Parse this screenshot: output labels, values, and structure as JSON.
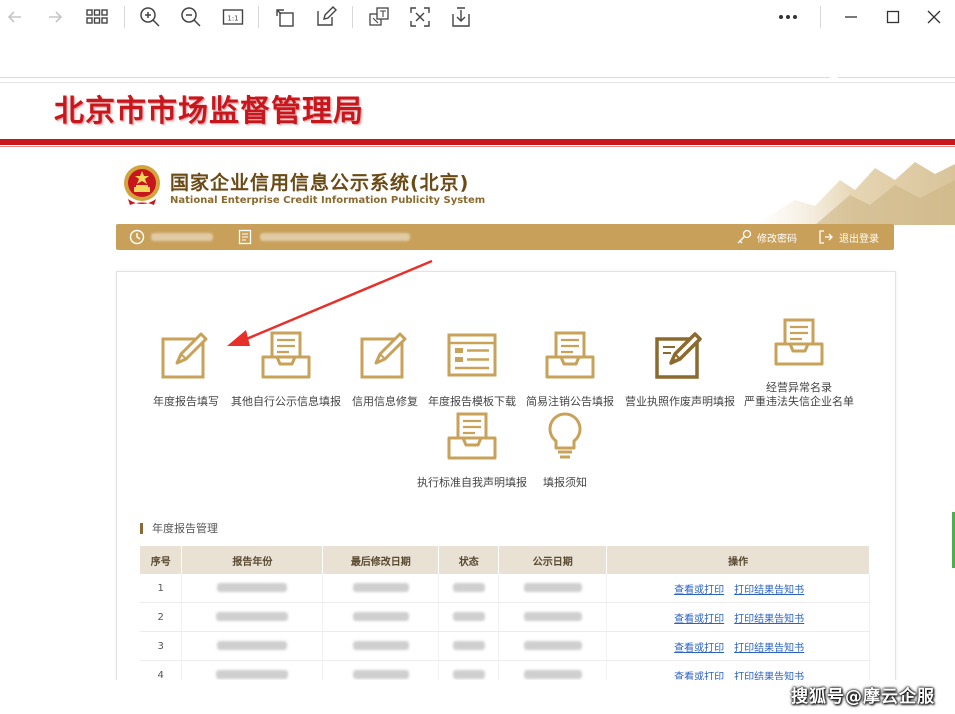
{
  "browser_toolbar": {
    "buttons": [
      {
        "name": "back-arrow-icon"
      },
      {
        "name": "forward-arrow-icon"
      },
      {
        "name": "grid-icon"
      },
      {
        "name": "zoom-in-icon"
      },
      {
        "name": "zoom-out-icon"
      },
      {
        "name": "actual-size-icon",
        "text": "1:1"
      },
      {
        "name": "rotate-icon"
      },
      {
        "name": "edit-icon"
      },
      {
        "name": "translate-icon"
      },
      {
        "name": "screenshot-icon"
      },
      {
        "name": "download-icon"
      }
    ],
    "window_controls": [
      "more-icon",
      "minimize-icon",
      "maximize-icon",
      "close-icon"
    ]
  },
  "header": {
    "bureau_title": "北京市市场监督管理局"
  },
  "system": {
    "title": "国家企业信用信息公示系统(北京)",
    "subtitle": "National Enterprise Credit Information Publicity System"
  },
  "userbar": {
    "change_password": "修改密码",
    "logout": "退出登录"
  },
  "tiles": [
    {
      "label": "年度报告填写",
      "icon": "pencil-board-icon"
    },
    {
      "label": "其他自行公示信息填报",
      "icon": "inbox-tray-icon"
    },
    {
      "label": "信用信息修复",
      "icon": "pencil-board-icon"
    },
    {
      "label": "年度报告模板下载",
      "icon": "template-form-icon"
    },
    {
      "label": "简易注销公告填报",
      "icon": "inbox-tray-icon"
    },
    {
      "label": "营业执照作废声明填报",
      "icon": "pencil-board-icon"
    },
    {
      "label": "经营异常名录",
      "label2": "严重违法失信企业名单",
      "icon": "inbox-tray-icon"
    },
    {
      "label": "执行标准自我声明填报",
      "icon": "inbox-tray-icon"
    },
    {
      "label": "填报须知",
      "icon": "lightbulb-icon"
    }
  ],
  "section": {
    "title": "年度报告管理"
  },
  "table": {
    "headers": [
      "序号",
      "报告年份",
      "最后修改日期",
      "状态",
      "公示日期",
      "操作"
    ],
    "rows": [
      {
        "no": "1",
        "view": "查看或打印",
        "print": "打印结果告知书"
      },
      {
        "no": "2",
        "view": "查看或打印",
        "print": "打印结果告知书"
      },
      {
        "no": "3",
        "view": "查看或打印",
        "print": "打印结果告知书"
      },
      {
        "no": "4",
        "view": "查看或打印",
        "print": "打印结果告知书"
      }
    ]
  },
  "watermark": "搜狐号@摩云企服",
  "colors": {
    "bureau_red": "#c8161d",
    "gold": "#c8a05a",
    "brown_title": "#6b4a16",
    "link_blue": "#2b62c1",
    "annotation_arrow": "#e8302a"
  }
}
